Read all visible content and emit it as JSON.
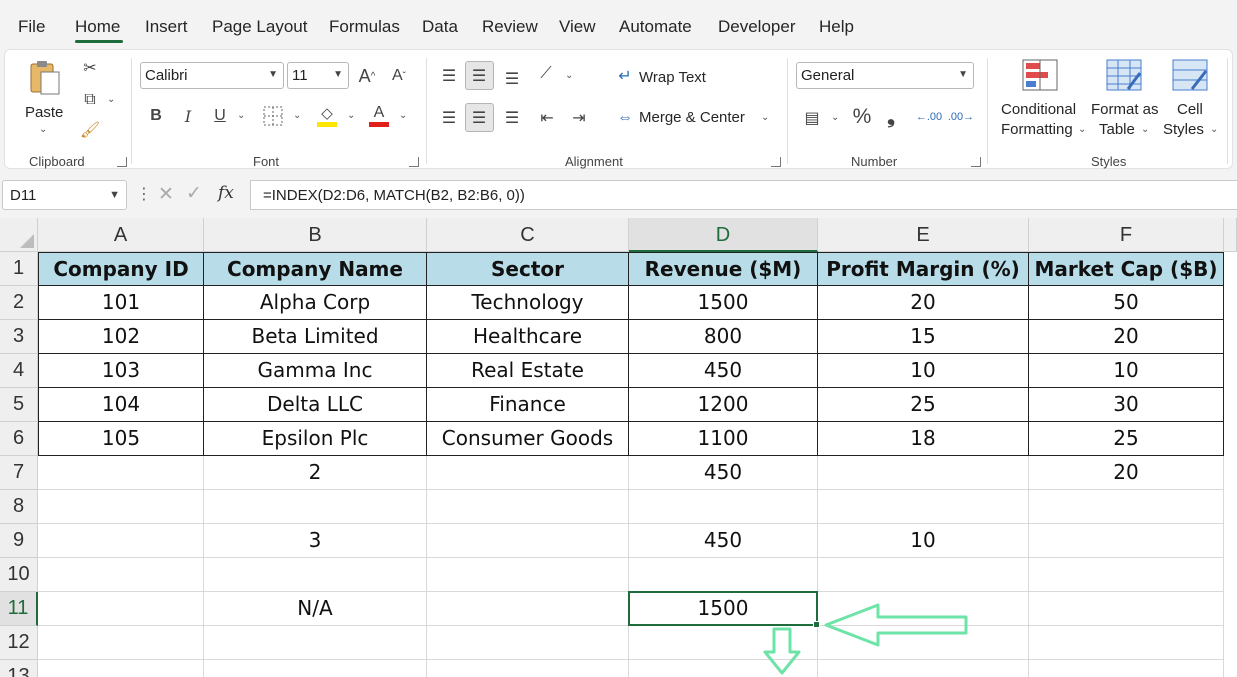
{
  "menu": {
    "tabs": [
      "File",
      "Home",
      "Insert",
      "Page Layout",
      "Formulas",
      "Data",
      "Review",
      "View",
      "Automate",
      "Developer",
      "Help"
    ],
    "active": "Home"
  },
  "ribbon": {
    "clipboard": {
      "paste": "Paste",
      "group": "Clipboard"
    },
    "font": {
      "name": "Calibri",
      "size": "11",
      "bold": "B",
      "italic": "I",
      "underline": "U",
      "grow": "A^",
      "shrink": "Aˇ",
      "group": "Font"
    },
    "alignment": {
      "wrap": "Wrap Text",
      "merge": "Merge & Center",
      "group": "Alignment"
    },
    "number": {
      "format": "General",
      "percent": "%",
      "comma": "❟",
      "inc": ".00",
      "dec": ".00",
      "group": "Number"
    },
    "styles": {
      "conditional_1": "Conditional",
      "conditional_2": "Formatting",
      "format_table_1": "Format as",
      "format_table_2": "Table",
      "cell_styles_1": "Cell",
      "cell_styles_2": "Styles",
      "group": "Styles"
    },
    "colors": {
      "accent": "#1e6b3c",
      "font_color": "#e0201c",
      "highlight": "#ffe600"
    }
  },
  "formula_bar": {
    "name_box": "D11",
    "formula": "=INDEX(D2:D6, MATCH(B2, B2:B6, 0))",
    "fx": "fx"
  },
  "sheet": {
    "columns": [
      "A",
      "B",
      "C",
      "D",
      "E",
      "F"
    ],
    "rows": [
      "1",
      "2",
      "3",
      "4",
      "5",
      "6",
      "7",
      "8",
      "9",
      "10",
      "11",
      "12",
      "13"
    ],
    "active_column": "D",
    "active_row": "11",
    "header": [
      "Company ID",
      "Company Name",
      "Sector",
      "Revenue ($M)",
      "Profit Margin (%)",
      "Market Cap ($B)"
    ],
    "data": [
      [
        "101",
        "Alpha Corp",
        "Technology",
        "1500",
        "20",
        "50"
      ],
      [
        "102",
        "Beta Limited",
        "Healthcare",
        "800",
        "15",
        "20"
      ],
      [
        "103",
        "Gamma Inc",
        "Real Estate",
        "450",
        "10",
        "10"
      ],
      [
        "104",
        "Delta LLC",
        "Finance",
        "1200",
        "25",
        "30"
      ],
      [
        "105",
        "Epsilon Plc",
        "Consumer Goods",
        "1100",
        "18",
        "25"
      ]
    ],
    "extra": {
      "row7": [
        "",
        "2",
        "",
        "450",
        "",
        "20"
      ],
      "row9": [
        "",
        "3",
        "",
        "450",
        "10",
        ""
      ],
      "row11": [
        "",
        "N/A",
        "",
        "1500",
        "",
        ""
      ]
    },
    "header_fill": "#b8dde8",
    "arrow_color": "#6ee3a8"
  }
}
